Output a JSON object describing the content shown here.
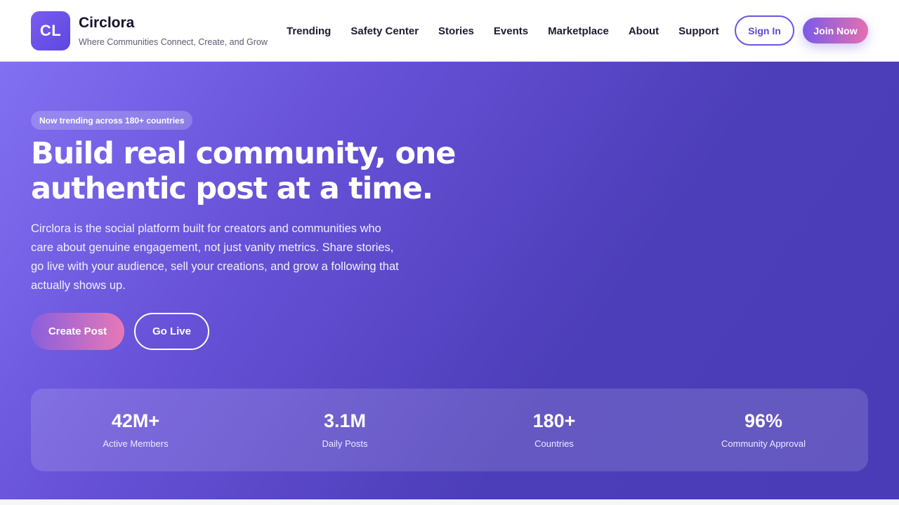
{
  "brand": {
    "logo_text": "CL",
    "name": "Circlora",
    "tagline": "Where Communities Connect, Create, and Grow"
  },
  "nav": {
    "items": [
      "Trending",
      "Safety Center",
      "Stories",
      "Events",
      "Marketplace",
      "About",
      "Support"
    ]
  },
  "header_actions": {
    "sign_in": "Sign In",
    "join": "Join Now"
  },
  "hero": {
    "badge": "Now trending across 180+ countries",
    "headline_line1": "Build real community, one",
    "headline_line2": "authentic post at a time.",
    "description": "Circlora is the social platform built for creators and communities who care about genuine engagement, not just vanity metrics. Share stories, go live with your audience, sell your creations, and grow a following that actually shows up.",
    "primary_cta": "Create Post",
    "secondary_cta": "Go Live"
  },
  "stats": [
    {
      "value": "42M+",
      "label": "Active Members"
    },
    {
      "value": "3.1M",
      "label": "Daily Posts"
    },
    {
      "value": "180+",
      "label": "Countries"
    },
    {
      "value": "96%",
      "label": "Community Approval"
    }
  ],
  "colors": {
    "brand_purple": "#6a55de",
    "gradient_pink": "#e878b6",
    "hero_dark": "#4a3cb6"
  }
}
